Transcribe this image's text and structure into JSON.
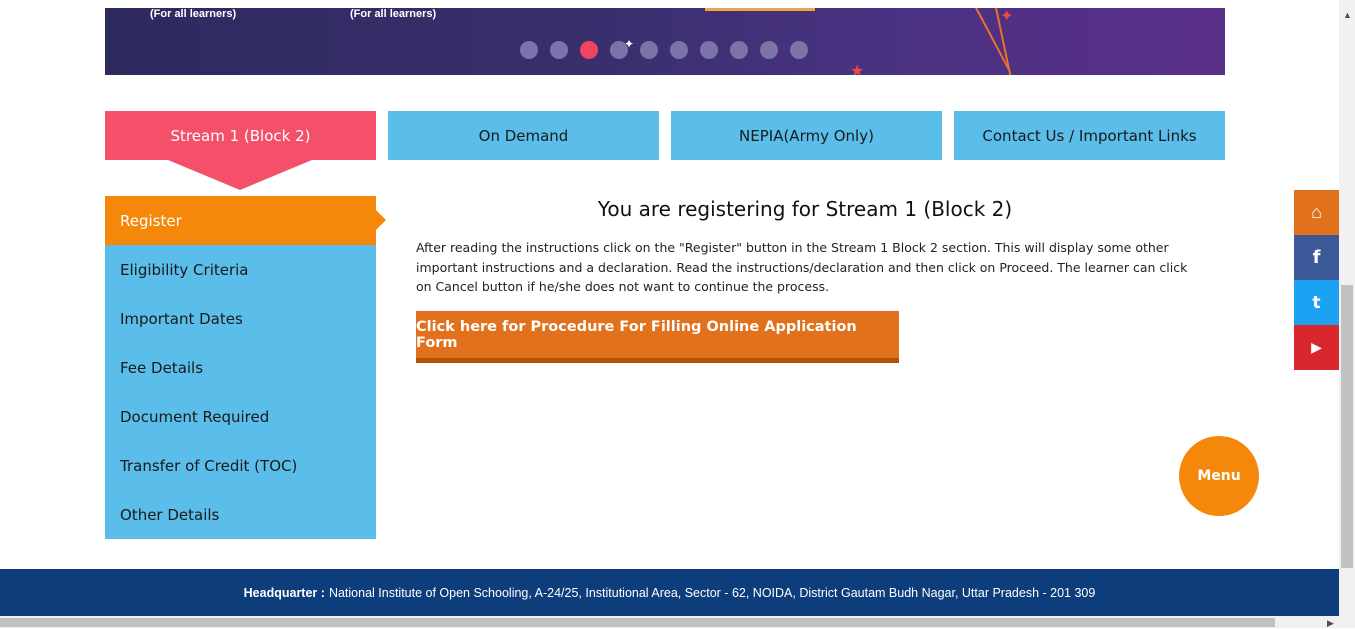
{
  "banner": {
    "captions": [
      "(For all learners)",
      "(For all learners)"
    ],
    "slide_count": 10,
    "active_slide": 3
  },
  "tabs": [
    {
      "label": "Stream 1 (Block 2)",
      "active": true
    },
    {
      "label": "On Demand",
      "active": false
    },
    {
      "label": "NEPIA(Army Only)",
      "active": false
    },
    {
      "label": "Contact Us / Important Links",
      "active": false
    }
  ],
  "sidebar": {
    "items": [
      {
        "label": "Register",
        "active": true
      },
      {
        "label": "Eligibility Criteria",
        "active": false
      },
      {
        "label": "Important Dates",
        "active": false
      },
      {
        "label": "Fee Details",
        "active": false
      },
      {
        "label": "Document Required",
        "active": false
      },
      {
        "label": "Transfer of Credit (TOC)",
        "active": false
      },
      {
        "label": "Other Details",
        "active": false
      }
    ]
  },
  "main": {
    "title": "You are registering for Stream 1 (Block 2)",
    "instructions": "After reading the instructions click on the \"Register\" button in the Stream 1 Block 2 section. This will display some other important instructions and a declaration. Read the instructions/declaration and then click on Proceed. The learner can click on Cancel button if he/she does not want to continue the process.",
    "procedure_button": "Click here for Procedure For Filling Online Application Form"
  },
  "social": [
    {
      "icon": "home-icon",
      "glyph": "⌂",
      "color": "#e2711d"
    },
    {
      "icon": "facebook-icon",
      "glyph": "f",
      "color": "#3b5998"
    },
    {
      "icon": "twitter-icon",
      "glyph": "t",
      "color": "#1da1f2"
    },
    {
      "icon": "youtube-icon",
      "glyph": "▶",
      "color": "#d9272e"
    }
  ],
  "menu_button": "Menu",
  "footer": {
    "label": "Headquarter :",
    "address": "National Institute of Open Schooling, A-24/25, Institutional Area, Sector - 62, NOIDA, District Gautam Budh Nagar, Uttar Pradesh - 201 309"
  },
  "colors": {
    "tab_active": "#f5506a",
    "tab_inactive": "#5bbde9",
    "sidebar_active": "#f5870a",
    "button": "#e2711d",
    "footer": "#0e3d7c"
  }
}
